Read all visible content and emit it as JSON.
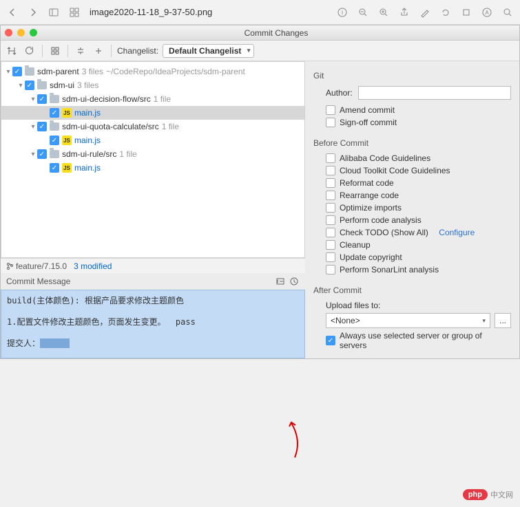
{
  "macWindow": {
    "filename": "image2020-11-18_9-37-50.png"
  },
  "dialog": {
    "title": "Commit Changes",
    "changelistLabel": "Changelist:",
    "changelistValue": "Default Changelist"
  },
  "tree": [
    {
      "depth": 0,
      "twisty": "▾",
      "cb": true,
      "icon": "folder",
      "name": "sdm-parent",
      "info": "3 files",
      "path": "~/CodeRepo/IdeaProjects/sdm-parent",
      "mod": false
    },
    {
      "depth": 1,
      "twisty": "▾",
      "cb": true,
      "icon": "folder",
      "name": "sdm-ui",
      "info": "3 files",
      "mod": false
    },
    {
      "depth": 2,
      "twisty": "▾",
      "cb": true,
      "icon": "folder",
      "name": "sdm-ui-decision-flow/src",
      "info": "1 file",
      "mod": false
    },
    {
      "depth": 3,
      "twisty": "",
      "cb": true,
      "icon": "js",
      "name": "main.js",
      "mod": true,
      "selected": true
    },
    {
      "depth": 2,
      "twisty": "▾",
      "cb": true,
      "icon": "folder",
      "name": "sdm-ui-quota-calculate/src",
      "info": "1 file",
      "mod": false
    },
    {
      "depth": 3,
      "twisty": "",
      "cb": true,
      "icon": "js",
      "name": "main.js",
      "mod": true
    },
    {
      "depth": 2,
      "twisty": "▾",
      "cb": true,
      "icon": "folder",
      "name": "sdm-ui-rule/src",
      "info": "1 file",
      "mod": false
    },
    {
      "depth": 3,
      "twisty": "",
      "cb": true,
      "icon": "js",
      "name": "main.js",
      "mod": true
    }
  ],
  "status": {
    "branch": "feature/7.15.0",
    "modified": "3 modified"
  },
  "commitMessage": {
    "title": "Commit Message",
    "line1": "build(主体颜色): 根据产品要求修改主题颜色",
    "line2": "1.配置文件修改主题颜色，页面发生变更。  pass",
    "line3": "提交人："
  },
  "right": {
    "git": "Git",
    "authorLabel": "Author:",
    "amend": "Amend commit",
    "signoff": "Sign-off commit",
    "beforeCommit": "Before Commit",
    "checks": [
      "Alibaba Code Guidelines",
      "Cloud Toolkit Code Guidelines",
      "Reformat code",
      "Rearrange code",
      "Optimize imports",
      "Perform code analysis"
    ],
    "todoLabel": "Check TODO (Show All)",
    "configure": "Configure",
    "checks2": [
      "Cleanup",
      "Update copyright",
      "Perform SonarLint analysis"
    ],
    "afterCommit": "After Commit",
    "uploadLabel": "Upload files to:",
    "uploadValue": "<None>",
    "uploadMore": "...",
    "alwaysUse": "Always use selected server or group of servers"
  },
  "watermark": {
    "logo": "php",
    "text": "中文网"
  }
}
